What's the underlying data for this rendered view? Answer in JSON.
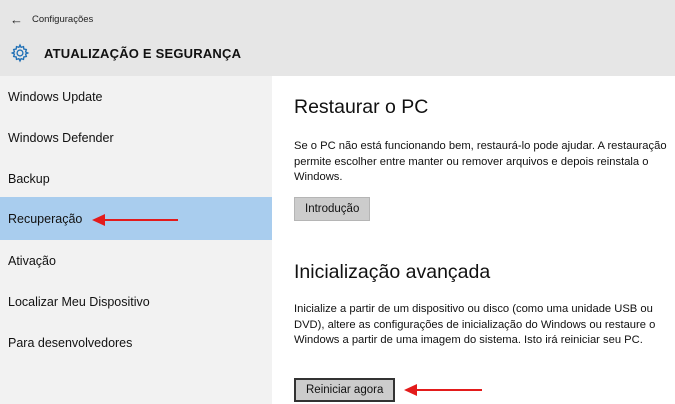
{
  "header": {
    "app_title": "Configurações",
    "section_title": "ATUALIZAÇÃO E SEGURANÇA"
  },
  "sidebar": {
    "items": [
      {
        "label": "Windows Update"
      },
      {
        "label": "Windows Defender"
      },
      {
        "label": "Backup"
      },
      {
        "label": "Recuperação",
        "selected": true
      },
      {
        "label": "Ativação"
      },
      {
        "label": "Localizar Meu Dispositivo"
      },
      {
        "label": "Para desenvolvedores"
      }
    ]
  },
  "main": {
    "reset": {
      "title": "Restaurar o PC",
      "description": "Se o PC não está funcionando bem, restaurá-lo pode ajudar. A restauração permite escolher entre manter ou remover arquivos e depois reinstala o Windows.",
      "button": "Introdução"
    },
    "advanced": {
      "title": "Inicialização avançada",
      "description": "Inicialize a partir de um dispositivo ou disco (como uma unidade USB ou DVD), altere as configurações de inicialização do Windows ou restaure o Windows a partir de uma imagem do sistema. Isto irá reiniciar seu PC.",
      "button": "Reiniciar agora"
    }
  },
  "colors": {
    "selected_bg": "#a9cdee",
    "annotation_arrow": "#e31b1b"
  }
}
